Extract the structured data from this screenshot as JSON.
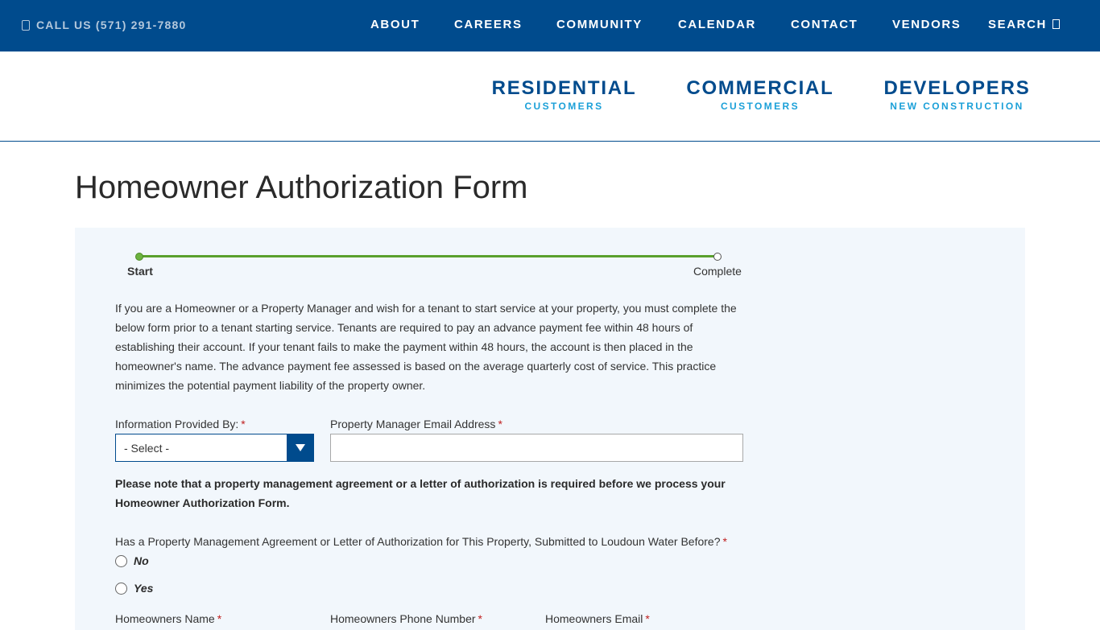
{
  "topbar": {
    "phone_label": "CALL US (571) 291-7880",
    "nav": [
      {
        "label": "ABOUT"
      },
      {
        "label": "CAREERS"
      },
      {
        "label": "COMMUNITY"
      },
      {
        "label": "CALENDAR"
      },
      {
        "label": "CONTACT"
      },
      {
        "label": "VENDORS"
      },
      {
        "label": "SEARCH"
      }
    ]
  },
  "mainnav": [
    {
      "title": "RESIDENTIAL",
      "subtitle": "CUSTOMERS"
    },
    {
      "title": "COMMERCIAL",
      "subtitle": "CUSTOMERS"
    },
    {
      "title": "DEVELOPERS",
      "subtitle": "NEW CONSTRUCTION"
    }
  ],
  "page_title": "Homeowner Authorization Form",
  "progress": {
    "start_label": "Start",
    "end_label": "Complete"
  },
  "intro_text": "If you are a Homeowner or a Property Manager and wish for a tenant to start service at your property, you must complete the below form prior to a tenant starting service. Tenants are required to pay an advance payment fee within 48 hours of establishing their account. If your tenant fails to make the payment within 48 hours, the account is then placed in the homeowner's name. The advance payment fee assessed is based on the average quarterly cost of service. This practice minimizes the potential payment liability of the property owner.",
  "fields": {
    "provided_by_label": "Information Provided By:",
    "provided_by_selected": "- Select -",
    "pm_email_label": "Property Manager Email Address",
    "pm_email_value": "",
    "required_mark": "*"
  },
  "note": "Please note that a property management agreement or a letter of authorization is required before we process your Homeowner Authorization Form.",
  "question": {
    "label": "Has a Property Management Agreement or Letter of Authorization for This Property, Submitted to Loudoun Water Before?",
    "options": [
      {
        "label": "No"
      },
      {
        "label": "Yes"
      }
    ]
  },
  "next_fields": [
    {
      "label": "Homeowners Name"
    },
    {
      "label": "Homeowners Phone Number"
    },
    {
      "label": "Homeowners Email"
    }
  ]
}
